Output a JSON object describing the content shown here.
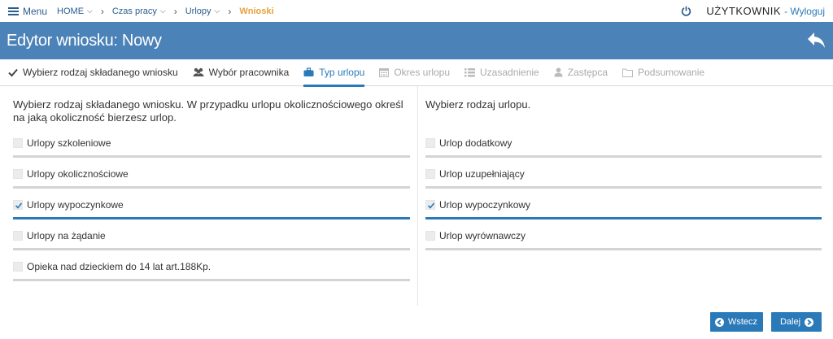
{
  "nav": {
    "menu_label": "Menu",
    "breadcrumbs": [
      {
        "label": "HOME",
        "has_dropdown": true
      },
      {
        "label": "Czas pracy",
        "has_dropdown": true
      },
      {
        "label": "Urlopy",
        "has_dropdown": true
      },
      {
        "label": "Wnioski",
        "has_dropdown": false
      }
    ],
    "user_label": "UŻYTKOWNIK",
    "logout_label": "- Wyloguj"
  },
  "header": {
    "title": "Edytor wniosku: Nowy"
  },
  "tabs": [
    {
      "label": "Wybierz rodzaj składanego wniosku",
      "icon": "check-icon",
      "state": "done"
    },
    {
      "label": "Wybór pracownika",
      "icon": "users-icon",
      "state": "done"
    },
    {
      "label": "Typ urlopu",
      "icon": "briefcase-icon",
      "state": "active"
    },
    {
      "label": "Okres urlopu",
      "icon": "calendar-icon",
      "state": "disabled"
    },
    {
      "label": "Uzasadnienie",
      "icon": "list-icon",
      "state": "disabled"
    },
    {
      "label": "Zastępca",
      "icon": "user-icon",
      "state": "disabled"
    },
    {
      "label": "Podsumowanie",
      "icon": "folder-icon",
      "state": "disabled"
    }
  ],
  "left": {
    "instruction": "Wybierz rodzaj składanego wniosku. W przypadku urlopu okolicznościowego określ na jaką okoliczność bierzesz urlop.",
    "options": [
      {
        "label": "Urlopy szkoleniowe",
        "checked": false
      },
      {
        "label": "Urlopy okolicznościowe",
        "checked": false
      },
      {
        "label": "Urlopy wypoczynkowe",
        "checked": true
      },
      {
        "label": "Urlopy na żądanie",
        "checked": false
      },
      {
        "label": "Opieka nad dzieckiem do 14 lat art.188Kp.",
        "checked": false
      }
    ]
  },
  "right": {
    "instruction": "Wybierz rodzaj urlopu.",
    "options": [
      {
        "label": "Urlop dodatkowy",
        "checked": false
      },
      {
        "label": "Urlop uzupełniający",
        "checked": false
      },
      {
        "label": "Urlop wypoczynkowy",
        "checked": true
      },
      {
        "label": "Urlop wyrównawczy",
        "checked": false
      }
    ]
  },
  "buttons": {
    "back_label": "Wstecz",
    "next_label": "Dalej"
  },
  "colors": {
    "header_bg": "#4b82b7",
    "accent": "#2a79b8",
    "breadcrumb_active": "#e8a13a"
  }
}
